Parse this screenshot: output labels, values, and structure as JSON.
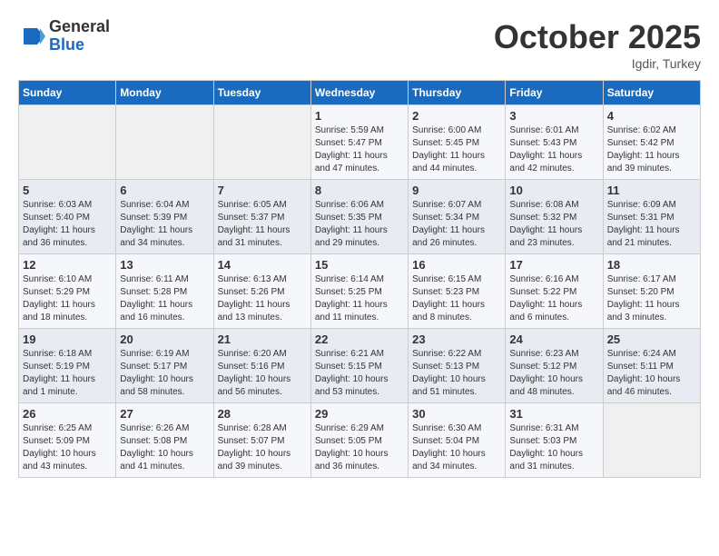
{
  "header": {
    "logo_general": "General",
    "logo_blue": "Blue",
    "month_title": "October 2025",
    "location": "Igdir, Turkey"
  },
  "days_of_week": [
    "Sunday",
    "Monday",
    "Tuesday",
    "Wednesday",
    "Thursday",
    "Friday",
    "Saturday"
  ],
  "weeks": [
    [
      {
        "day": "",
        "info": ""
      },
      {
        "day": "",
        "info": ""
      },
      {
        "day": "",
        "info": ""
      },
      {
        "day": "1",
        "info": "Sunrise: 5:59 AM\nSunset: 5:47 PM\nDaylight: 11 hours and 47 minutes."
      },
      {
        "day": "2",
        "info": "Sunrise: 6:00 AM\nSunset: 5:45 PM\nDaylight: 11 hours and 44 minutes."
      },
      {
        "day": "3",
        "info": "Sunrise: 6:01 AM\nSunset: 5:43 PM\nDaylight: 11 hours and 42 minutes."
      },
      {
        "day": "4",
        "info": "Sunrise: 6:02 AM\nSunset: 5:42 PM\nDaylight: 11 hours and 39 minutes."
      }
    ],
    [
      {
        "day": "5",
        "info": "Sunrise: 6:03 AM\nSunset: 5:40 PM\nDaylight: 11 hours and 36 minutes."
      },
      {
        "day": "6",
        "info": "Sunrise: 6:04 AM\nSunset: 5:39 PM\nDaylight: 11 hours and 34 minutes."
      },
      {
        "day": "7",
        "info": "Sunrise: 6:05 AM\nSunset: 5:37 PM\nDaylight: 11 hours and 31 minutes."
      },
      {
        "day": "8",
        "info": "Sunrise: 6:06 AM\nSunset: 5:35 PM\nDaylight: 11 hours and 29 minutes."
      },
      {
        "day": "9",
        "info": "Sunrise: 6:07 AM\nSunset: 5:34 PM\nDaylight: 11 hours and 26 minutes."
      },
      {
        "day": "10",
        "info": "Sunrise: 6:08 AM\nSunset: 5:32 PM\nDaylight: 11 hours and 23 minutes."
      },
      {
        "day": "11",
        "info": "Sunrise: 6:09 AM\nSunset: 5:31 PM\nDaylight: 11 hours and 21 minutes."
      }
    ],
    [
      {
        "day": "12",
        "info": "Sunrise: 6:10 AM\nSunset: 5:29 PM\nDaylight: 11 hours and 18 minutes."
      },
      {
        "day": "13",
        "info": "Sunrise: 6:11 AM\nSunset: 5:28 PM\nDaylight: 11 hours and 16 minutes."
      },
      {
        "day": "14",
        "info": "Sunrise: 6:13 AM\nSunset: 5:26 PM\nDaylight: 11 hours and 13 minutes."
      },
      {
        "day": "15",
        "info": "Sunrise: 6:14 AM\nSunset: 5:25 PM\nDaylight: 11 hours and 11 minutes."
      },
      {
        "day": "16",
        "info": "Sunrise: 6:15 AM\nSunset: 5:23 PM\nDaylight: 11 hours and 8 minutes."
      },
      {
        "day": "17",
        "info": "Sunrise: 6:16 AM\nSunset: 5:22 PM\nDaylight: 11 hours and 6 minutes."
      },
      {
        "day": "18",
        "info": "Sunrise: 6:17 AM\nSunset: 5:20 PM\nDaylight: 11 hours and 3 minutes."
      }
    ],
    [
      {
        "day": "19",
        "info": "Sunrise: 6:18 AM\nSunset: 5:19 PM\nDaylight: 11 hours and 1 minute."
      },
      {
        "day": "20",
        "info": "Sunrise: 6:19 AM\nSunset: 5:17 PM\nDaylight: 10 hours and 58 minutes."
      },
      {
        "day": "21",
        "info": "Sunrise: 6:20 AM\nSunset: 5:16 PM\nDaylight: 10 hours and 56 minutes."
      },
      {
        "day": "22",
        "info": "Sunrise: 6:21 AM\nSunset: 5:15 PM\nDaylight: 10 hours and 53 minutes."
      },
      {
        "day": "23",
        "info": "Sunrise: 6:22 AM\nSunset: 5:13 PM\nDaylight: 10 hours and 51 minutes."
      },
      {
        "day": "24",
        "info": "Sunrise: 6:23 AM\nSunset: 5:12 PM\nDaylight: 10 hours and 48 minutes."
      },
      {
        "day": "25",
        "info": "Sunrise: 6:24 AM\nSunset: 5:11 PM\nDaylight: 10 hours and 46 minutes."
      }
    ],
    [
      {
        "day": "26",
        "info": "Sunrise: 6:25 AM\nSunset: 5:09 PM\nDaylight: 10 hours and 43 minutes."
      },
      {
        "day": "27",
        "info": "Sunrise: 6:26 AM\nSunset: 5:08 PM\nDaylight: 10 hours and 41 minutes."
      },
      {
        "day": "28",
        "info": "Sunrise: 6:28 AM\nSunset: 5:07 PM\nDaylight: 10 hours and 39 minutes."
      },
      {
        "day": "29",
        "info": "Sunrise: 6:29 AM\nSunset: 5:05 PM\nDaylight: 10 hours and 36 minutes."
      },
      {
        "day": "30",
        "info": "Sunrise: 6:30 AM\nSunset: 5:04 PM\nDaylight: 10 hours and 34 minutes."
      },
      {
        "day": "31",
        "info": "Sunrise: 6:31 AM\nSunset: 5:03 PM\nDaylight: 10 hours and 31 minutes."
      },
      {
        "day": "",
        "info": ""
      }
    ]
  ]
}
